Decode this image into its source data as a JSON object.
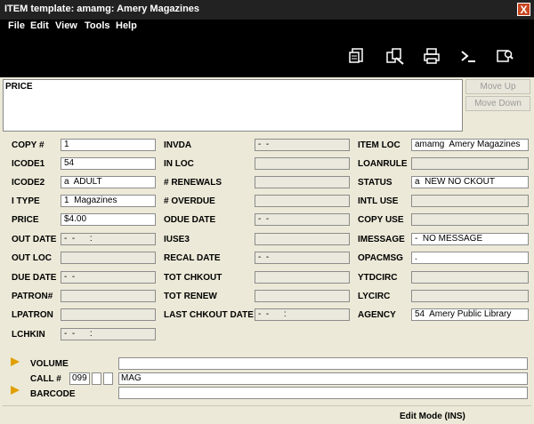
{
  "window": {
    "title": "ITEM template: amamg: Amery Magazines",
    "close_symbol": "X"
  },
  "menu": [
    {
      "label": "File"
    },
    {
      "label": "Edit"
    },
    {
      "label": "View"
    },
    {
      "label": "Tools"
    },
    {
      "label": "Help"
    }
  ],
  "toolbar": [
    {
      "icon": "record-icon"
    },
    {
      "icon": "edit-record-icon"
    },
    {
      "icon": "print-icon"
    },
    {
      "icon": "command-prompt-icon"
    },
    {
      "icon": "search-record-icon"
    }
  ],
  "price_panel": {
    "label": "PRICE",
    "move_up": "Move Up",
    "move_down": "Move Down"
  },
  "fields": {
    "copy_num": {
      "label": "COPY #",
      "value": "1"
    },
    "icode1": {
      "label": "ICODE1",
      "value": "54"
    },
    "icode2": {
      "label": "ICODE2",
      "value": "a  ADULT"
    },
    "itype": {
      "label": "I TYPE",
      "value": "1  Magazines"
    },
    "price": {
      "label": "PRICE",
      "value": "$4.00"
    },
    "out_date": {
      "label": "OUT DATE",
      "value": "-  -      :"
    },
    "out_loc": {
      "label": "OUT LOC",
      "value": ""
    },
    "due_date": {
      "label": "DUE DATE",
      "value": "-  -"
    },
    "patron_num": {
      "label": "PATRON#",
      "value": ""
    },
    "lpatron": {
      "label": "LPATRON",
      "value": ""
    },
    "lchkin": {
      "label": "LCHKIN",
      "value": "-  -      :"
    },
    "invda": {
      "label": "INVDA",
      "value": "-  -"
    },
    "in_loc": {
      "label": "IN LOC",
      "value": ""
    },
    "renewals": {
      "label": "# RENEWALS",
      "value": ""
    },
    "overdue": {
      "label": "# OVERDUE",
      "value": ""
    },
    "odue_date": {
      "label": "ODUE DATE",
      "value": "-  -"
    },
    "iuse3": {
      "label": "IUSE3",
      "value": ""
    },
    "recal_date": {
      "label": "RECAL DATE",
      "value": "-  -"
    },
    "tot_chkout": {
      "label": "TOT CHKOUT",
      "value": ""
    },
    "tot_renew": {
      "label": "TOT RENEW",
      "value": ""
    },
    "last_chkout_date": {
      "label": "LAST CHKOUT DATE",
      "value": "-  -      :"
    },
    "item_loc": {
      "label": "ITEM LOC",
      "value": "amamg  Amery Magazines"
    },
    "loanrule": {
      "label": "LOANRULE",
      "value": ""
    },
    "status": {
      "label": "STATUS",
      "value": "a  NEW NO CKOUT"
    },
    "intl_use": {
      "label": "INTL USE",
      "value": ""
    },
    "copy_use": {
      "label": "COPY USE",
      "value": ""
    },
    "imessage": {
      "label": "IMESSAGE",
      "value": "-  NO MESSAGE"
    },
    "opacmsg": {
      "label": "OPACMSG",
      "value": "."
    },
    "ytdcirc": {
      "label": "YTDCIRC",
      "value": ""
    },
    "lycirc": {
      "label": "LYCIRC",
      "value": ""
    },
    "agency": {
      "label": "AGENCY",
      "value": "54  Amery Public Library"
    }
  },
  "varfields": {
    "volume": {
      "label": "VOLUME",
      "value": ""
    },
    "call": {
      "label": "CALL #",
      "tag": "099",
      "ind1": "",
      "ind2": "",
      "value": "MAG"
    },
    "barcode": {
      "label": "BARCODE",
      "value": ""
    }
  },
  "status_bar": {
    "mode": "Edit Mode (INS)"
  },
  "colors": {
    "title_bg": "#222222",
    "close_bg": "#c8461f",
    "arrow": "#e0a000"
  }
}
